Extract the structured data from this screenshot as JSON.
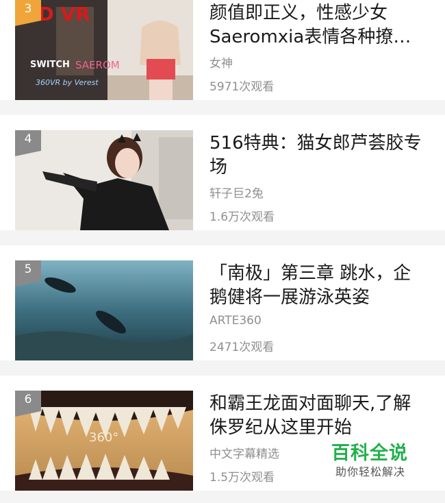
{
  "items": [
    {
      "rank": "3",
      "title_l1": "颜值即正义，性感少女",
      "title_l2": "Saeromxia表情各种撩…",
      "author": "女神",
      "views": "5971次观看",
      "thumb_text": {
        "vr": "3D VR",
        "switch": "SWITCH",
        "saerom": "SAEROM",
        "by": "360VR by Verest"
      }
    },
    {
      "rank": "4",
      "title_l1": "516特典：猫女郎芦荟胶专",
      "title_l2": "场",
      "author": "轩子巨2兔",
      "views": "1.6万次观看"
    },
    {
      "rank": "5",
      "title_l1": "「南极」第三章 跳水，企",
      "title_l2": "鹅健将一展游泳英姿",
      "author": "ARTE360",
      "views": "2471次观看"
    },
    {
      "rank": "6",
      "title_l1": "和霸王龙面对面聊天,了解",
      "title_l2": "侏罗纪从这里开始",
      "author": "中文字幕精选",
      "views": "1.5万次观看",
      "thumb_text": {
        "badge": "360°"
      }
    }
  ],
  "watermark": {
    "main": "百科全说",
    "sub": "助你轻松解决"
  },
  "colors": {
    "rank_top": "#f0a53b",
    "rank_rest": "#8a8a8a",
    "watermark": "#22b14c",
    "meta_text": "#8f8f8f"
  }
}
